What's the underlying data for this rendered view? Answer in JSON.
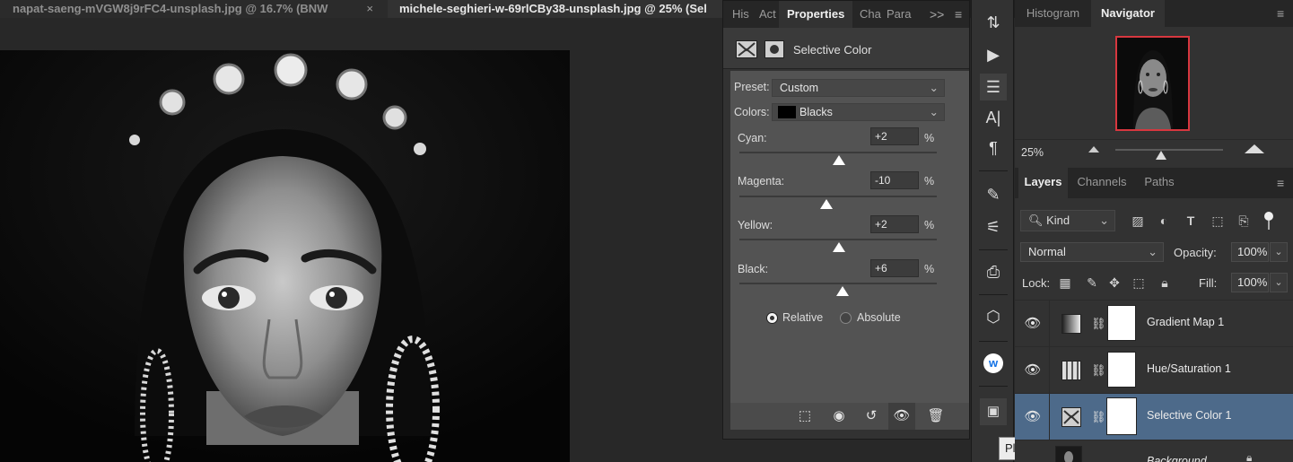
{
  "doc_tabs": [
    {
      "label": "napat-saeng-mVGW8j9rFC4-unsplash.jpg @ 16.7% (BNW",
      "close": "×"
    },
    {
      "label": "michele-seghieri-w-69rlCBy38-unsplash.jpg @ 25% (Sel"
    }
  ],
  "properties": {
    "tabs": [
      "His",
      "Act",
      "Properties",
      "Cha",
      "Para"
    ],
    "overflow": ">>",
    "menu": "≡",
    "title": "Selective Color",
    "preset_label": "Preset:",
    "preset_value": "Custom",
    "colors_label": "Colors:",
    "colors_value": "Blacks",
    "sliders": [
      {
        "label": "Cyan:",
        "value": "+2",
        "unit": "%"
      },
      {
        "label": "Magenta:",
        "value": "-10",
        "unit": "%"
      },
      {
        "label": "Yellow:",
        "value": "+2",
        "unit": "%"
      },
      {
        "label": "Black:",
        "value": "+6",
        "unit": "%"
      }
    ],
    "method_relative": "Relative",
    "method_absolute": "Absolute",
    "method_selected": "Relative"
  },
  "toolstrip": {
    "tooltip": "Plugins",
    "plugin_badge": "w"
  },
  "navigator": {
    "tabs": [
      "Histogram",
      "Navigator"
    ],
    "menu": "≡",
    "zoom": "25%"
  },
  "layers": {
    "tabs": [
      "Layers",
      "Channels",
      "Paths"
    ],
    "menu": "≡",
    "filter_kind": "Kind",
    "blend_mode": "Normal",
    "opacity_label": "Opacity:",
    "opacity_value": "100%",
    "lock_label": "Lock:",
    "fill_label": "Fill:",
    "fill_value": "100%",
    "items": [
      {
        "name": "Gradient Map 1",
        "icon": "gradient-map-icon",
        "selected": false
      },
      {
        "name": "Hue/Saturation 1",
        "icon": "hue-saturation-icon",
        "selected": false
      },
      {
        "name": "Selective Color 1",
        "icon": "selective-color-icon",
        "selected": true
      },
      {
        "name": "Background",
        "icon": "image-thumbnail",
        "selected": false
      }
    ]
  },
  "colors": {
    "panel": "#323232",
    "selected_layer": "#4d6a8a",
    "navigator_frame": "#d7373f"
  }
}
